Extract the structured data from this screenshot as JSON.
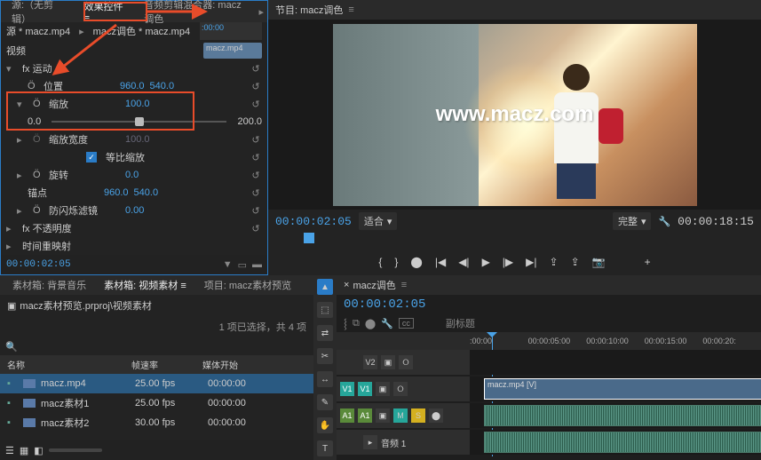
{
  "source_tabs": {
    "no_clip": "源:（无剪辑）",
    "effects": "效果控件",
    "mixer": "音频剪辑混合器: macz调色"
  },
  "source_clip": "源 * macz.mp4",
  "sequence_clip_ref": "macz调色 * macz.mp4",
  "timeline_clip_label": "macz.mp4",
  "video_section": "视频",
  "motion": {
    "label": "fx 运动",
    "position": {
      "label": "位置",
      "toggle": "Ö",
      "x": "960.0",
      "y": "540.0"
    },
    "scale": {
      "label": "缩放",
      "toggle": "Ö",
      "value": "100.0",
      "min": "0.0",
      "max": "200.0"
    },
    "scale_w": {
      "label": "缩放宽度",
      "toggle": "Ö",
      "value": "100.0"
    },
    "uniform": {
      "label": "等比缩放",
      "checked": true
    },
    "rotation": {
      "label": "旋转",
      "toggle": "Ö",
      "value": "0.0"
    },
    "anchor": {
      "label": "锚点",
      "x": "960.0",
      "y": "540.0"
    },
    "antiflicker": {
      "label": "防闪烁滤镜",
      "toggle": "Ö",
      "value": "0.00"
    }
  },
  "opacity": {
    "label": "fx 不透明度"
  },
  "time_remap": {
    "label": "时间重映射"
  },
  "panel_tc": "00:00:02:05",
  "program": {
    "tab": "节目: macz调色",
    "watermark": "www.macz.com",
    "tc_current": "00:00:02:05",
    "fit": "适合",
    "view": "完整",
    "tc_duration": "00:00:18:15"
  },
  "project": {
    "tabs": {
      "bgm": "素材箱: 背景音乐",
      "video": "素材箱: 视频素材",
      "preview": "项目: macz素材预览"
    },
    "crumb": "macz素材预览.prproj\\视频素材",
    "status": "1 项已选择，共 4 项",
    "columns": {
      "name": "名称",
      "fps": "帧速率",
      "start": "媒体开始"
    },
    "items": [
      {
        "name": "macz.mp4",
        "fps": "25.00 fps",
        "start": "00:00:00"
      },
      {
        "name": "macz素材1",
        "fps": "25.00 fps",
        "start": "00:00:00"
      },
      {
        "name": "macz素材2",
        "fps": "30.00 fps",
        "start": "00:00:00"
      }
    ]
  },
  "sequence": {
    "tab": "macz调色",
    "tc": "00:00:02:05",
    "subtitle": "副标题",
    "ruler": [
      ":00:00",
      "00:00:05:00",
      "00:00:10:00",
      "00:00:15:00",
      "00:00:20:"
    ],
    "v2": "V2",
    "v1": "V1",
    "a1": "A1",
    "a2": "音频 1",
    "vclip": "macz.mp4 [V]",
    "btns": {
      "m": "M",
      "s": "S"
    }
  },
  "icons": {
    "chev_down": "▾",
    "chev_right": "▸",
    "reset": "↺",
    "menu": "≡",
    "close": "×",
    "folder": "▣",
    "search": "🔍",
    "wrench": "🔧",
    "plus": "+",
    "lock": "🔒",
    "snap": "⸾",
    "link": "⧉",
    "marker": "⬤",
    "eye": "👁",
    "cc": "cc",
    "step_back": "|◀",
    "prev": "◀◀",
    "frame_back": "◀|",
    "play": "▶",
    "frame_fwd": "|▶",
    "next": "▶▶",
    "step_fwd": "▶|",
    "in": "{",
    "out": "}",
    "export": "⇪",
    "camera": "📷",
    "arrow_tool": "▲",
    "track_sel": "⬚",
    "ripple": "⇄",
    "razor": "✂",
    "slip": "↔",
    "pen": "✎",
    "hand": "✋",
    "type": "T"
  }
}
